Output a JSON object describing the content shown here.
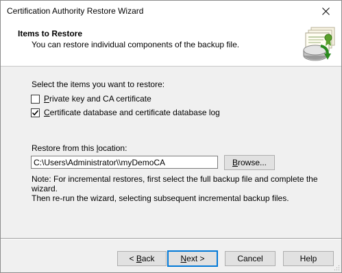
{
  "window": {
    "title": "Certification Authority Restore Wizard"
  },
  "header": {
    "title": "Items to Restore",
    "subtitle": "You can restore individual components of the backup file."
  },
  "main": {
    "instruction": "Select the items you want to restore:",
    "options": [
      {
        "label_pre": "",
        "label_key": "P",
        "label_post": "rivate key and CA certificate",
        "checked": false
      },
      {
        "label_pre": "",
        "label_key": "C",
        "label_post": "ertificate database and certificate database log",
        "checked": true
      }
    ],
    "location_label_pre": "Restore from this ",
    "location_label_key": "l",
    "location_label_post": "ocation:",
    "location_value": "C:\\Users\\Administrator\\\\myDemoCA",
    "browse_pre": "",
    "browse_key": "B",
    "browse_post": "rowse...",
    "note_line1": "Note: For incremental restores, first select the full backup file and complete the wizard.",
    "note_line2": "Then re-run the wizard, selecting subsequent incremental backup files."
  },
  "footer": {
    "back_pre": "< ",
    "back_key": "B",
    "back_post": "ack",
    "next_pre": "",
    "next_key": "N",
    "next_post": "ext >",
    "cancel_label": "Cancel",
    "help_label": "Help"
  },
  "colors": {
    "accent": "#0078d7",
    "dialog_bg": "#f0f0f0"
  },
  "icons": {
    "close": "close-icon",
    "header_graphic": "certificate-backup-icon",
    "check": "checkmark-icon"
  }
}
